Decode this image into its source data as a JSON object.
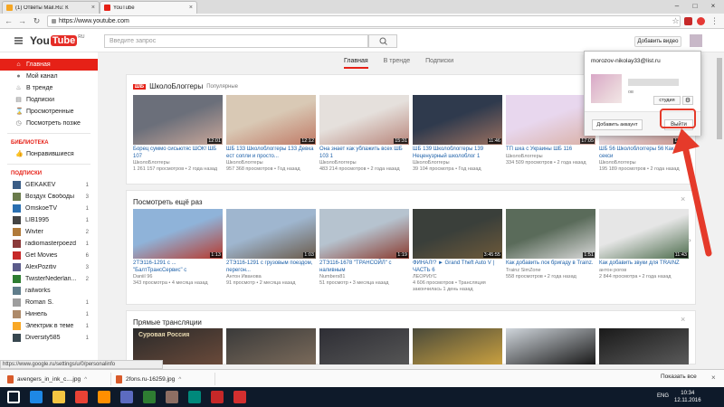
{
  "browser": {
    "tabs": [
      {
        "label": "(1) Ответы Mail.Ru: К",
        "active": false
      },
      {
        "label": "YouTube",
        "active": true
      }
    ],
    "url": "https://www.youtube.com",
    "status_url": "https://www.google.ru/settings/u/0/personalinfo"
  },
  "header": {
    "logo_you": "You",
    "logo_tube": "Tube",
    "logo_region": "RU",
    "search_placeholder": "Введите запрос",
    "upload_label": "Добавить видео"
  },
  "sidebar": {
    "main": [
      {
        "label": "Главная",
        "icon": "home-icon",
        "glyph": "⌂",
        "active": true
      },
      {
        "label": "Мой канал",
        "icon": "person-icon",
        "glyph": "●"
      },
      {
        "label": "В тренде",
        "icon": "flame-icon",
        "glyph": "♨"
      },
      {
        "label": "Подписки",
        "icon": "subscriptions-icon",
        "glyph": "▤"
      },
      {
        "label": "Просмотренные",
        "icon": "history-icon",
        "glyph": "⌛"
      },
      {
        "label": "Посмотреть позже",
        "icon": "clock-icon",
        "glyph": "◷"
      }
    ],
    "library_heading": "БИБЛИОТЕКА",
    "library": [
      {
        "label": "Понравившиеся",
        "icon": "thumb-up-icon",
        "glyph": "👍"
      }
    ],
    "subs_heading": "ПОДПИСКИ",
    "subscriptions": [
      {
        "name": "GEKAKEV",
        "count": "1",
        "color": "#3a5d86"
      },
      {
        "name": "Воздух Свободы",
        "count": "3",
        "color": "#6a7b4b"
      },
      {
        "name": "OmskoeTV",
        "count": "1",
        "color": "#2a6fb0"
      },
      {
        "name": "LIB1995",
        "count": "1",
        "color": "#444444"
      },
      {
        "name": "Wivter",
        "count": "2",
        "color": "#b07a3a"
      },
      {
        "name": "radiomasterpoezd",
        "count": "1",
        "color": "#8b3a3a"
      },
      {
        "name": "Get Movies",
        "count": "6",
        "color": "#c62828"
      },
      {
        "name": "AlexPozitiv",
        "count": "3",
        "color": "#5b5b8a"
      },
      {
        "name": "TwisterNederlan...",
        "count": "2",
        "color": "#2e7d32"
      },
      {
        "name": "railworks",
        "count": "",
        "color": "#607d8b"
      },
      {
        "name": "Roman S.",
        "count": "1",
        "color": "#9e9e9e"
      },
      {
        "name": "Нинель",
        "count": "1",
        "color": "#ad8a6a"
      },
      {
        "name": "Электрик в теме",
        "count": "1",
        "color": "#f9a825"
      },
      {
        "name": "Diversity585",
        "count": "1",
        "color": "#37474f"
      }
    ]
  },
  "main_tabs": [
    {
      "label": "Главная",
      "active": true
    },
    {
      "label": "В тренде"
    },
    {
      "label": "Подписки"
    }
  ],
  "shelves": [
    {
      "badge": "ШБ",
      "title": "ШколоБлоггеры",
      "subtitle": "Популярные",
      "videos": [
        {
          "title": "Борец суммо сисьютяс ШОК! ШБ 107",
          "channel": "ШколоБлоггеры",
          "meta": "1 261 157 просмотров • 2 года назад",
          "duration": "12:01",
          "c1": "#6b6f7a",
          "c2": "#c9a79a"
        },
        {
          "title": "ШБ 133 Школоблоггеры 133 Девка ест сопли и просто...",
          "channel": "ШколоБлоггеры",
          "meta": "957 368 просмотров • Год назад",
          "duration": "12:12",
          "c1": "#d9c9b5",
          "c2": "#c07a66"
        },
        {
          "title": "Она знает как ублажить всех ШБ 103 1",
          "channel": "ШколоБлоггеры",
          "meta": "483 214 просмотров • 2 года назад",
          "duration": "15:31",
          "c1": "#e5e0dc",
          "c2": "#b8857a"
        },
        {
          "title": "ШБ 139 Школоблоггеры 139 Неценузрный школоблог 1",
          "channel": "ШколоБлоггеры",
          "meta": "39 104 просмотра • Год назад",
          "duration": "11:46",
          "c1": "#2f3a4d",
          "c2": "#9a7060"
        },
        {
          "title": "ТП шка с Украины ШБ 116",
          "channel": "ШколоБлоггеры",
          "meta": "334 509 просмотров • 2 года назад",
          "duration": "17:05",
          "c1": "#e8d7ee",
          "c2": "#d9b0a5"
        },
        {
          "title": "ШБ 56 Школоблоггеры 56 Как стать секси",
          "channel": "ШколоБлоггеры",
          "meta": "195 189 просмотров • 2 года назад",
          "duration": "12:29",
          "c1": "#efe9ef",
          "c2": "#c9928a"
        }
      ]
    },
    {
      "badge": "",
      "title": "Посмотреть ещё раз",
      "subtitle": "",
      "videos": [
        {
          "title": "2ТЭ116-1291 с ... \"БалтТрансСервис\" с",
          "channel": "Daniil 96",
          "meta": "343 просмотра • 4 месяца назад",
          "duration": "1:13",
          "c1": "#8fb3d9",
          "c2": "#b73a2e"
        },
        {
          "title": "2ТЭ116-1291 с грузовым поездом, перегон...",
          "channel": "Антон Иванова",
          "meta": "91 просмотр • 2 месяца назад",
          "duration": "1:03",
          "c1": "#9fb6cf",
          "c2": "#6a5a4a"
        },
        {
          "title": "2ТЭ116-1678 \"ТРАНСОЙЛ\" с наливным",
          "channel": "Numbers81",
          "meta": "51 просмотр • 3 месяца назад",
          "duration": "1:19",
          "c1": "#b6c3cf",
          "c2": "#8a3a2e"
        },
        {
          "title": "ФИНАЛ!? ► Grand Theft Auto V | ЧАСТЬ 6",
          "channel": "ЛЕОРИУС",
          "meta": "4 606 просмотров • Трансляция закончилась 1 день назад",
          "duration": "3:45:55",
          "c1": "#3a3f3a",
          "c2": "#6e5a3a"
        },
        {
          "title": "Как добавить лок бригаду в Trainz.",
          "channel": "Trainz SimZone",
          "meta": "558 просмотров • 2 года назад",
          "duration": "1:51",
          "c1": "#5a6b5a",
          "c2": "#d9d9d9"
        },
        {
          "title": "Как добавить звуки для TRAINZ",
          "channel": "антон рогов",
          "meta": "2 844 просмотра • 2 года назад",
          "duration": "11:43",
          "c1": "#e6e6e6",
          "c2": "#4b6b4b"
        }
      ]
    }
  ],
  "live": {
    "title": "Прямые трансляции",
    "thumbs": [
      {
        "text": "Суровая Россия",
        "c1": "#2a2a2a",
        "c2": "#6a4a3a"
      },
      {
        "text": "",
        "c1": "#3a3a3a",
        "c2": "#7a6a5a"
      },
      {
        "text": "",
        "c1": "#2e2e35",
        "c2": "#555"
      },
      {
        "text": "",
        "c1": "#4a4a3a",
        "c2": "#c9a040"
      },
      {
        "text": "",
        "c1": "#d0d6dc",
        "c2": "#1a1a1a"
      },
      {
        "text": "",
        "c1": "#1a1a1a",
        "c2": "#5a5a5a"
      }
    ]
  },
  "account_popup": {
    "email": "morozov-nikolay33@list.ru",
    "sub": "ов",
    "studio_label": "студия",
    "add_account_label": "Добавить аккаунт",
    "signout_label": "Выйти"
  },
  "downloads": {
    "items": [
      {
        "label": "avengers_in_ink_c....jpg"
      },
      {
        "label": "2fons.ru-16259.jpg"
      }
    ],
    "show_all_label": "Показать все"
  },
  "taskbar": {
    "lang": "ENG",
    "time": "10:34",
    "date": "12.11.2016",
    "apps": [
      {
        "icon": "windows-start-icon",
        "color": "#ffffff"
      },
      {
        "icon": "ie-icon",
        "color": "#1e88e5"
      },
      {
        "icon": "explorer-icon",
        "color": "#f4c542"
      },
      {
        "icon": "chrome-icon",
        "color": "#e94235"
      },
      {
        "icon": "media-player-icon",
        "color": "#ff8f00"
      },
      {
        "icon": "app-icon",
        "color": "#5c6bc0"
      },
      {
        "icon": "app-icon",
        "color": "#2e7d32"
      },
      {
        "icon": "app-icon",
        "color": "#8d6e63"
      },
      {
        "icon": "app-icon",
        "color": "#00897b"
      },
      {
        "icon": "app-icon",
        "color": "#c62828"
      },
      {
        "icon": "app-icon",
        "color": "#d32f2f"
      }
    ]
  }
}
